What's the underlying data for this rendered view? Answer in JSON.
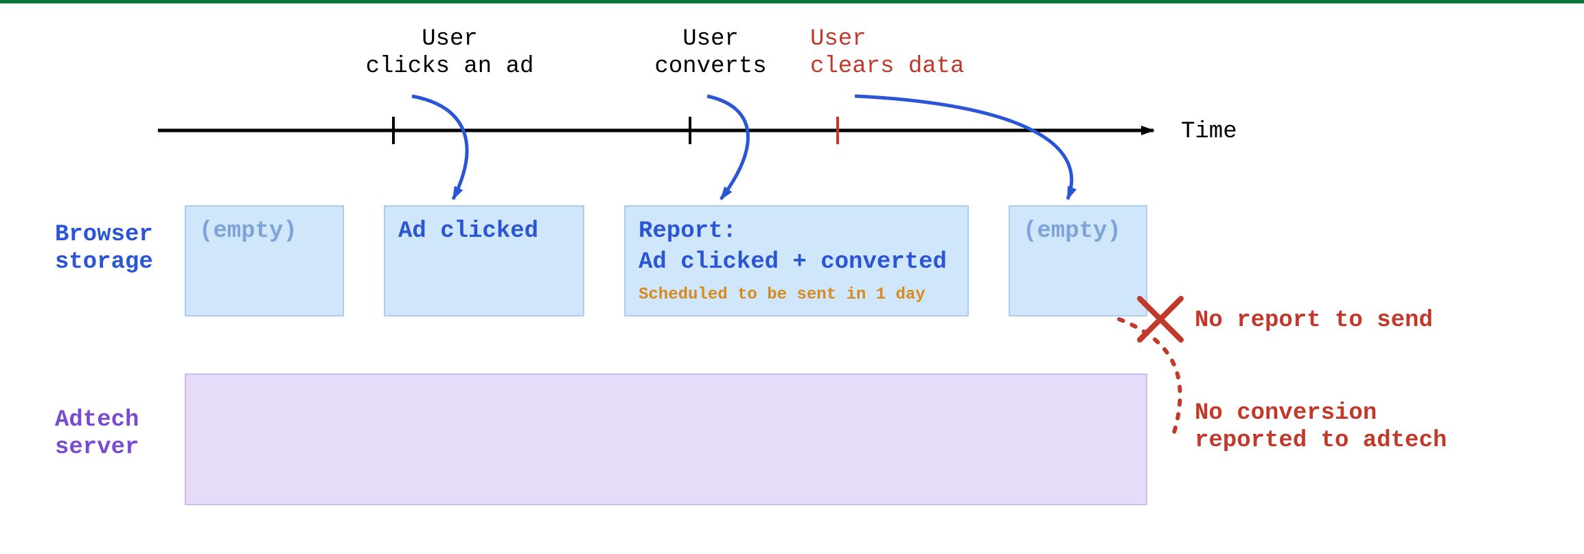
{
  "colors": {
    "black": "#000000",
    "blue_text": "#2a55d4",
    "blue_box_fill": "#cfe6fb",
    "blue_box_stroke": "#a9cef0",
    "blue_muted": "#7fa3d9",
    "red": "#c0392b",
    "orange": "#d98a1c",
    "purple_text": "#7a4ad0",
    "purple_fill": "#e6dcf9",
    "purple_stroke": "#cbbdf0",
    "arrow_blue": "#2a55d4",
    "top_bar": "#0a7a3a"
  },
  "timeline": {
    "axis_label": "Time",
    "events": {
      "click": {
        "line1": "User",
        "line2": "clicks an ad",
        "color_key": "black"
      },
      "convert": {
        "line1": "User",
        "line2": "converts",
        "color_key": "black"
      },
      "clear": {
        "line1": "User",
        "line2": "clears data",
        "color_key": "red"
      }
    }
  },
  "rows": {
    "browser": {
      "label_line1": "Browser",
      "label_line2": "storage"
    },
    "adtech": {
      "label_line1": "Adtech",
      "label_line2": "server"
    }
  },
  "storage_states": {
    "empty1": {
      "text": "(empty)"
    },
    "clicked": {
      "text": "Ad clicked"
    },
    "report": {
      "line1": "Report:",
      "line2": "Ad clicked + converted",
      "subtext": "Scheduled to be sent in 1 day"
    },
    "empty2": {
      "text": "(empty)"
    }
  },
  "failure": {
    "top_label": "No report to send",
    "bottom_line1": "No conversion",
    "bottom_line2": "reported to adtech"
  }
}
